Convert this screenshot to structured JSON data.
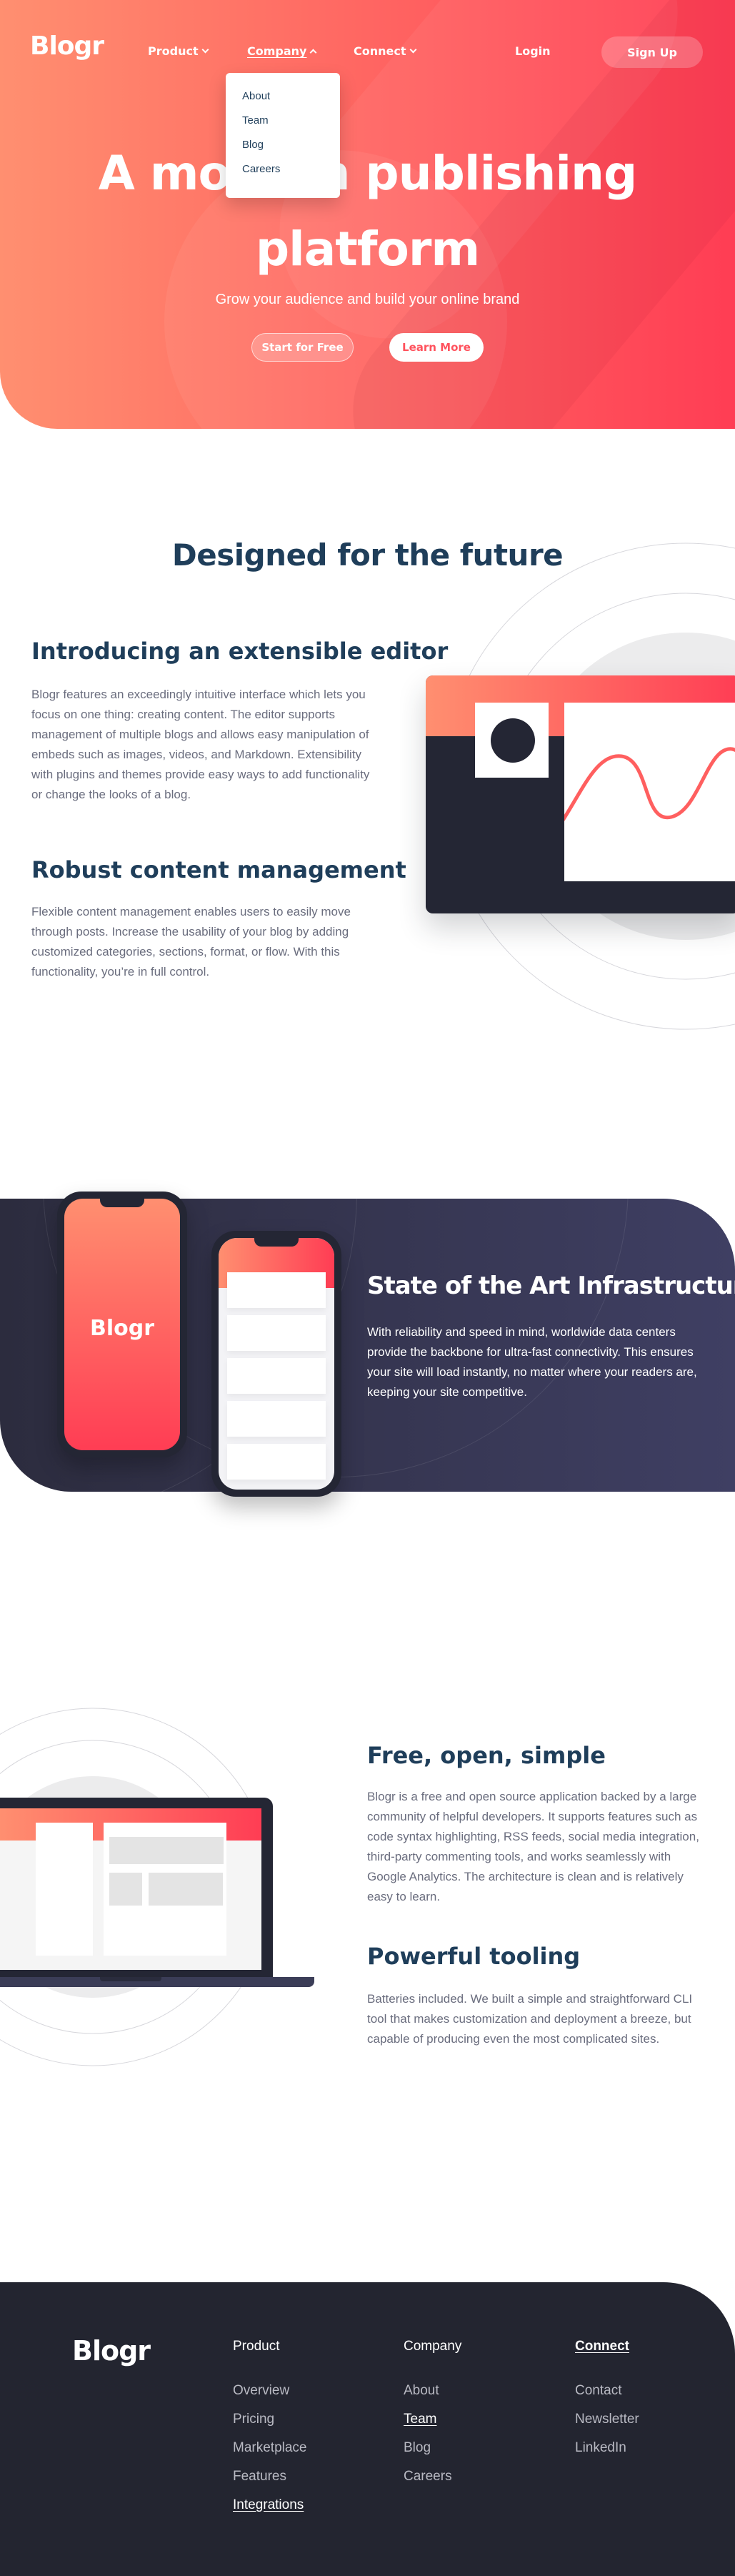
{
  "brand": {
    "name": "Blogr",
    "accent_start": "#ff8f70",
    "accent_end": "#ff3d54",
    "navy": "#1f3e5a",
    "dark": "#232530"
  },
  "nav": {
    "product": "Product",
    "company": "Company",
    "connect": "Connect",
    "login": "Login",
    "signup": "Sign Up",
    "company_menu": [
      "About",
      "Team",
      "Blog",
      "Careers"
    ]
  },
  "hero": {
    "title_line1": "A modern publishing",
    "title_line2": "platform",
    "subtitle": "Grow your audience and build your online brand",
    "start_btn": "Start for Free",
    "learn_btn": "Learn More"
  },
  "designed": {
    "title": "Designed for the future",
    "editor_title": "Introducing an extensible editor",
    "editor_text": "Blogr features an exceedingly intuitive interface which lets you focus on one thing: creating content. The editor supports management of multiple blogs and allows easy manipulation of embeds such as images, videos, and Markdown. Extensibility with plugins and themes provide easy ways to add functionality or change the looks of a blog.",
    "content_title": "Robust content management",
    "content_text": "Flexible content management enables users to easily move through posts. Increase the usability of your blog by adding customized categories, sections, format, or flow. With this functionality, you’re in full control."
  },
  "infra": {
    "title": "State of the Art Infrastructure",
    "text": "With reliability and speed in mind, worldwide data centers provide the backbone for ultra-fast connectivity. This ensures your site will load instantly, no matter where your readers are, keeping your site competitive.",
    "phone_brand": "Blogr"
  },
  "free": {
    "title": "Free, open, simple",
    "text": "Blogr is a free and open source application backed by a large community of helpful developers. It supports features such as code syntax highlighting, RSS feeds, social media integration, third-party commenting tools, and works seamlessly with Google Analytics. The architecture is clean and is relatively easy to learn."
  },
  "tooling": {
    "title": "Powerful tooling",
    "text": "Batteries included. We built a simple and straightforward CLI tool that makes customization and deployment a breeze, but capable of producing even the most complicated sites."
  },
  "footer": {
    "logo": "Blogr",
    "product": {
      "heading": "Product",
      "links": [
        "Overview",
        "Pricing",
        "Marketplace",
        "Features",
        "Integrations"
      ]
    },
    "company": {
      "heading": "Company",
      "links": [
        "About",
        "Team",
        "Blog",
        "Careers"
      ]
    },
    "connect": {
      "heading": "Connect",
      "links": [
        "Contact",
        "Newsletter",
        "LinkedIn"
      ]
    }
  }
}
